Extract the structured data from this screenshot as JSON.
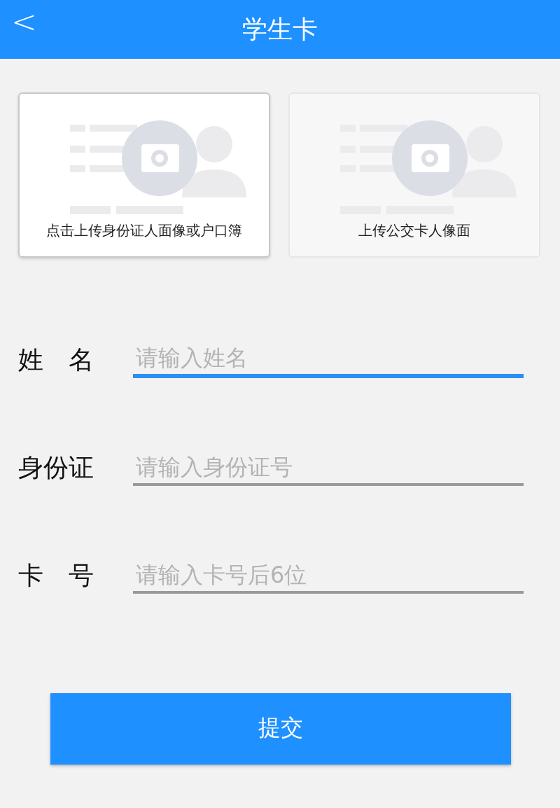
{
  "header": {
    "back": "<",
    "title": "学生卡"
  },
  "upload_cards": [
    {
      "caption": "点击上传身份证人面像或户口簿",
      "highlighted": true
    },
    {
      "caption": "上传公交卡人像面",
      "highlighted": false
    }
  ],
  "fields": [
    {
      "label": "姓　名",
      "placeholder": "请输入姓名",
      "focused": true
    },
    {
      "label": "身份证",
      "placeholder": "请输入身份证号",
      "focused": false
    },
    {
      "label": "卡　号",
      "placeholder": "请输入卡号后6位",
      "focused": false
    }
  ],
  "submit": "提交"
}
